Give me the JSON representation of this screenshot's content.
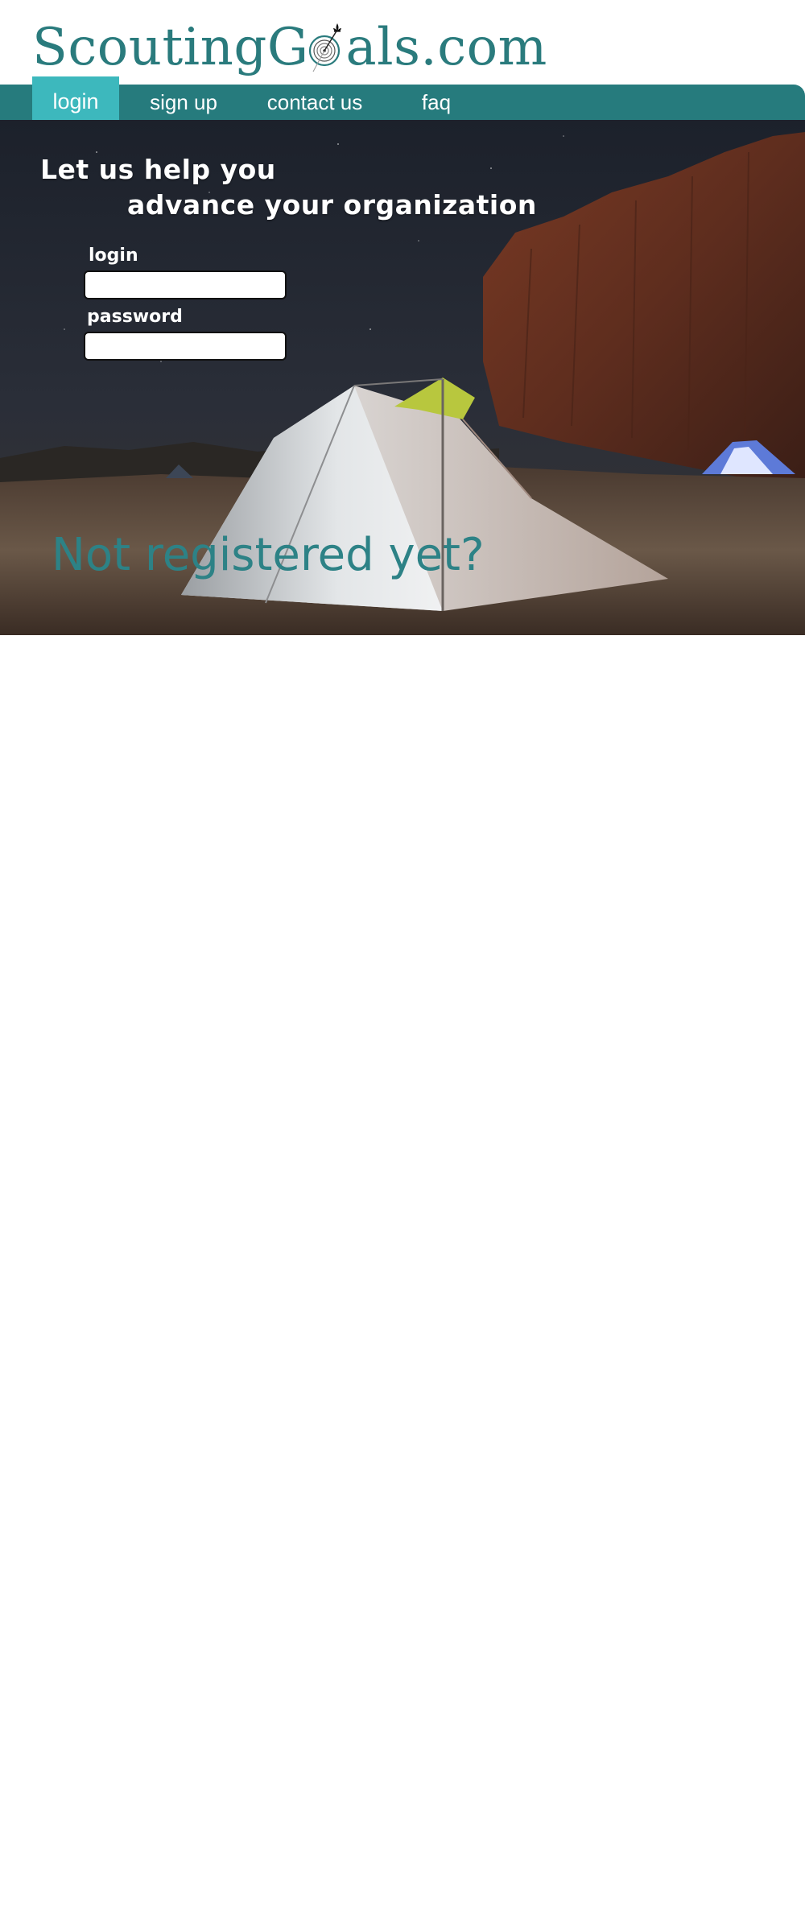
{
  "brand": {
    "logo_pre": "ScoutingG",
    "logo_post": "als.com",
    "logo_icon": "target-with-fleur-de-lis-icon",
    "color": "#2a7b7d"
  },
  "nav": {
    "bar_color": "#267b7d",
    "active_color": "#3db8bd",
    "items": [
      {
        "label": "login",
        "active": true
      },
      {
        "label": "sign up",
        "active": false
      },
      {
        "label": "contact us",
        "active": false
      },
      {
        "label": "faq",
        "active": false
      }
    ]
  },
  "hero": {
    "headline_line1": "Let us help you",
    "headline_line2": "advance your organization",
    "login_label": "login",
    "login_value": "",
    "password_label": "password",
    "password_value": "",
    "not_registered": "Not registered yet?",
    "not_registered_color": "#2d8286",
    "background_image": "night-camp-tent-under-cliffs"
  }
}
